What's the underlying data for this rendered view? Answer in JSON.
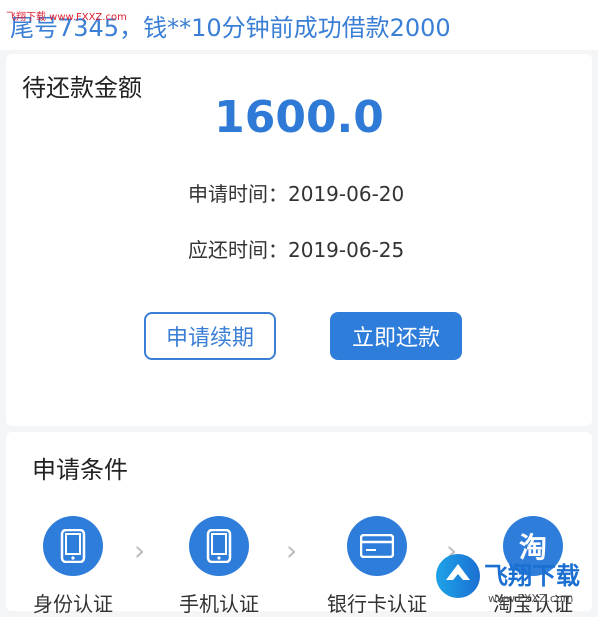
{
  "ticker": {
    "text": "尾号7345，钱**10分钟前成功借款2000"
  },
  "watermark_top": "飞翔下载 www.FXXZ.com",
  "repay": {
    "title": "待还款金额",
    "amount": "1600.0",
    "apply_label": "申请时间：",
    "apply_date": "2019-06-20",
    "due_label": "应还时间：",
    "due_date": "2019-06-25",
    "renew_button": "申请续期",
    "pay_button": "立即还款"
  },
  "conditions": {
    "title": "申请条件",
    "steps": [
      {
        "label": "身份认证",
        "icon": "phone-icon"
      },
      {
        "label": "手机认证",
        "icon": "phone-icon"
      },
      {
        "label": "银行卡认证",
        "icon": "bank-card-icon"
      },
      {
        "label": "淘宝认证",
        "icon": "taobao-icon"
      }
    ]
  },
  "logo": {
    "text": "飞翔下载",
    "url": "www.FXXZ.com"
  },
  "colors": {
    "accent": "#2f7ddb",
    "ticker": "#3a7fd5"
  }
}
